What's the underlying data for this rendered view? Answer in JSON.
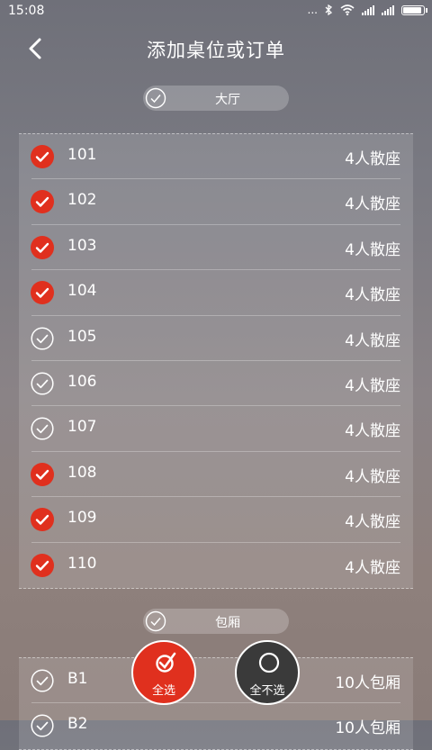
{
  "status_bar": {
    "time": "15:08",
    "more": "...",
    "bluetooth": "bluetooth-icon",
    "wifi": "wifi-icon",
    "battery": "battery-icon"
  },
  "header": {
    "title": "添加桌位或订单",
    "back_icon": "chevron-left-icon"
  },
  "sections": [
    {
      "label": "大厅",
      "tables": [
        {
          "number": "101",
          "type": "4人散座",
          "selected": true
        },
        {
          "number": "102",
          "type": "4人散座",
          "selected": true
        },
        {
          "number": "103",
          "type": "4人散座",
          "selected": true
        },
        {
          "number": "104",
          "type": "4人散座",
          "selected": true
        },
        {
          "number": "105",
          "type": "4人散座",
          "selected": false
        },
        {
          "number": "106",
          "type": "4人散座",
          "selected": false
        },
        {
          "number": "107",
          "type": "4人散座",
          "selected": false
        },
        {
          "number": "108",
          "type": "4人散座",
          "selected": true
        },
        {
          "number": "109",
          "type": "4人散座",
          "selected": true
        },
        {
          "number": "110",
          "type": "4人散座",
          "selected": true
        }
      ]
    },
    {
      "label": "包厢",
      "tables": [
        {
          "number": "B1",
          "type": "10人包厢",
          "selected": false
        },
        {
          "number": "B2",
          "type": "10人包厢",
          "selected": false
        }
      ]
    }
  ],
  "actions": {
    "select_all": "全选",
    "select_none": "全不选"
  },
  "colors": {
    "accent": "#e0301e",
    "dark_button": "#3a3a3a"
  }
}
